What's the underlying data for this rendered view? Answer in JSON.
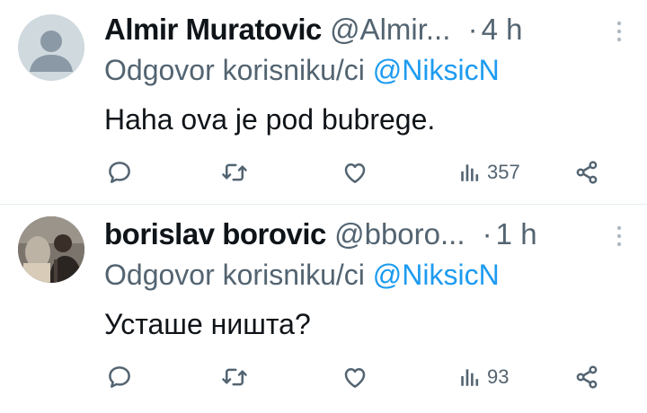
{
  "tweets": [
    {
      "display_name": "Almir Muratovic",
      "handle": "@Almir...",
      "separator": "·",
      "time": "4 h",
      "reply_prefix": "Odgovor korisniku/ci",
      "reply_mention": "@NiksicN",
      "text": "Haha ova je pod bubrege.",
      "avatar": "default-avatar-icon",
      "views": "357"
    },
    {
      "display_name": "borislav borovic",
      "handle": "@bboro...",
      "separator": "·",
      "time": "1 h",
      "reply_prefix": "Odgovor korisniku/ci",
      "reply_mention": "@NiksicN",
      "text": "Усташе ништа?",
      "avatar": "photo-avatar",
      "views": "93"
    }
  ],
  "colors": {
    "text_primary": "#0f1419",
    "text_secondary": "#536471",
    "mention": "#1d9bf0",
    "divider": "#e6ecf0",
    "default_avatar_bg": "#cfd9de"
  },
  "icons": [
    "more-icon",
    "reply-icon",
    "repost-icon",
    "like-icon",
    "views-icon",
    "share-icon"
  ]
}
